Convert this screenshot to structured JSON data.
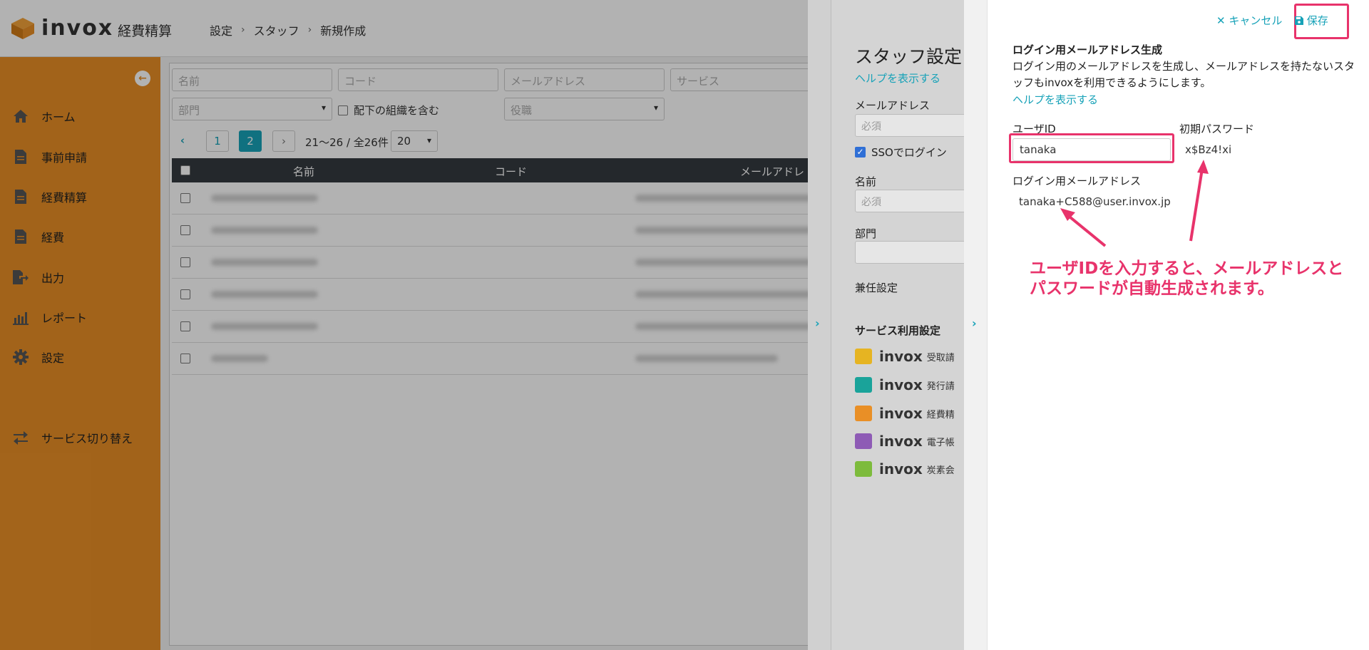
{
  "header": {
    "logo_text": "invox",
    "logo_sub": "経費精算",
    "breadcrumb": [
      "設定",
      "スタッフ",
      "新規作成"
    ]
  },
  "sidebar": {
    "items": [
      {
        "label": "ホーム",
        "icon": "home-icon"
      },
      {
        "label": "事前申請",
        "icon": "document-icon"
      },
      {
        "label": "経費精算",
        "icon": "document-icon"
      },
      {
        "label": "経費",
        "icon": "document-icon"
      },
      {
        "label": "出力",
        "icon": "export-icon"
      },
      {
        "label": "レポート",
        "icon": "chart-icon"
      },
      {
        "label": "設定",
        "icon": "gear-icon"
      }
    ],
    "switch_label": "サービス切り替え"
  },
  "filters": {
    "name_placeholder": "名前",
    "code_placeholder": "コード",
    "email_placeholder": "メールアドレス",
    "service_placeholder": "サービス",
    "department_placeholder": "部門",
    "include_sub_label": "配下の組織を含む",
    "role_placeholder": "役職"
  },
  "pagination": {
    "pages": [
      "1",
      "2"
    ],
    "active_page": "2",
    "range_text": "21〜26 / 全26件",
    "per_page": "20"
  },
  "table": {
    "headers": [
      "名前",
      "コード",
      "メールアドレ"
    ]
  },
  "drawer1": {
    "title": "スタッフ設定",
    "help": "ヘルプを表示する",
    "email_label": "メールアドレス",
    "email_placeholder": "必須",
    "sso_label": "SSOでログイン",
    "name_label": "名前",
    "name_placeholder": "必須",
    "dept_label": "部門",
    "concurrent_label": "兼任設定",
    "service_heading": "サービス利用設定",
    "services": [
      {
        "name": "invox",
        "sub": "受取請",
        "color": "#e6b422"
      },
      {
        "name": "invox",
        "sub": "発行請",
        "color": "#1aa39a"
      },
      {
        "name": "invox",
        "sub": "経費精",
        "color": "#e98f26"
      },
      {
        "name": "invox",
        "sub": "電子帳",
        "color": "#8e5bb5"
      },
      {
        "name": "invox",
        "sub": "炭素会",
        "color": "#7dbb3c"
      }
    ]
  },
  "drawer2": {
    "cancel": "キャンセル",
    "save": "保存",
    "heading": "ログイン用メールアドレス生成",
    "description": "ログイン用のメールアドレスを生成し、メールアドレスを持たないスタッフもinvoxを利用できるようにします。",
    "help": "ヘルプを表示する",
    "user_id_label": "ユーザID",
    "user_id_value": "tanaka",
    "initial_password_label": "初期パスワード",
    "initial_password_value": "x$Bz4!xi",
    "login_email_label": "ログイン用メールアドレス",
    "login_email_value": "tanaka+C588@user.invox.jp"
  },
  "annotation": {
    "line1": "ユーザIDを入力すると、メールアドレスと",
    "line2": "パスワードが自動生成されます。"
  },
  "colors": {
    "brand_orange": "#e98f26",
    "accent_teal": "#17a2b8",
    "highlight_pink": "#e8336b"
  }
}
